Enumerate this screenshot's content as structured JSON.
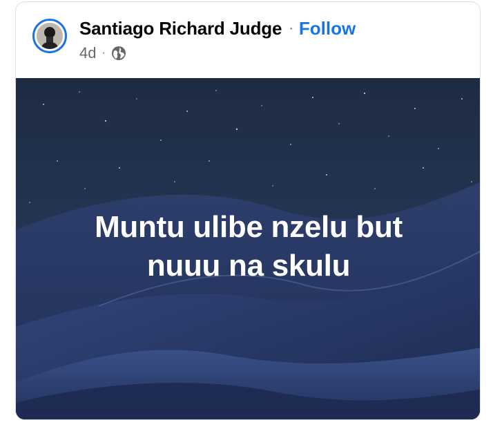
{
  "post": {
    "author": "Santiago Richard Judge",
    "separator": "·",
    "follow_label": "Follow",
    "timestamp": "4d",
    "meta_separator": "·",
    "audience_icon": "globe-icon",
    "image_text_line1": "Muntu ulibe nzelu but",
    "image_text_line2": "nuuu na skulu"
  },
  "colors": {
    "follow": "#1b74e4",
    "name": "#050505",
    "secondary": "#65676b",
    "sky_top": "#1f2c44",
    "dunes": "#2a3a63"
  }
}
